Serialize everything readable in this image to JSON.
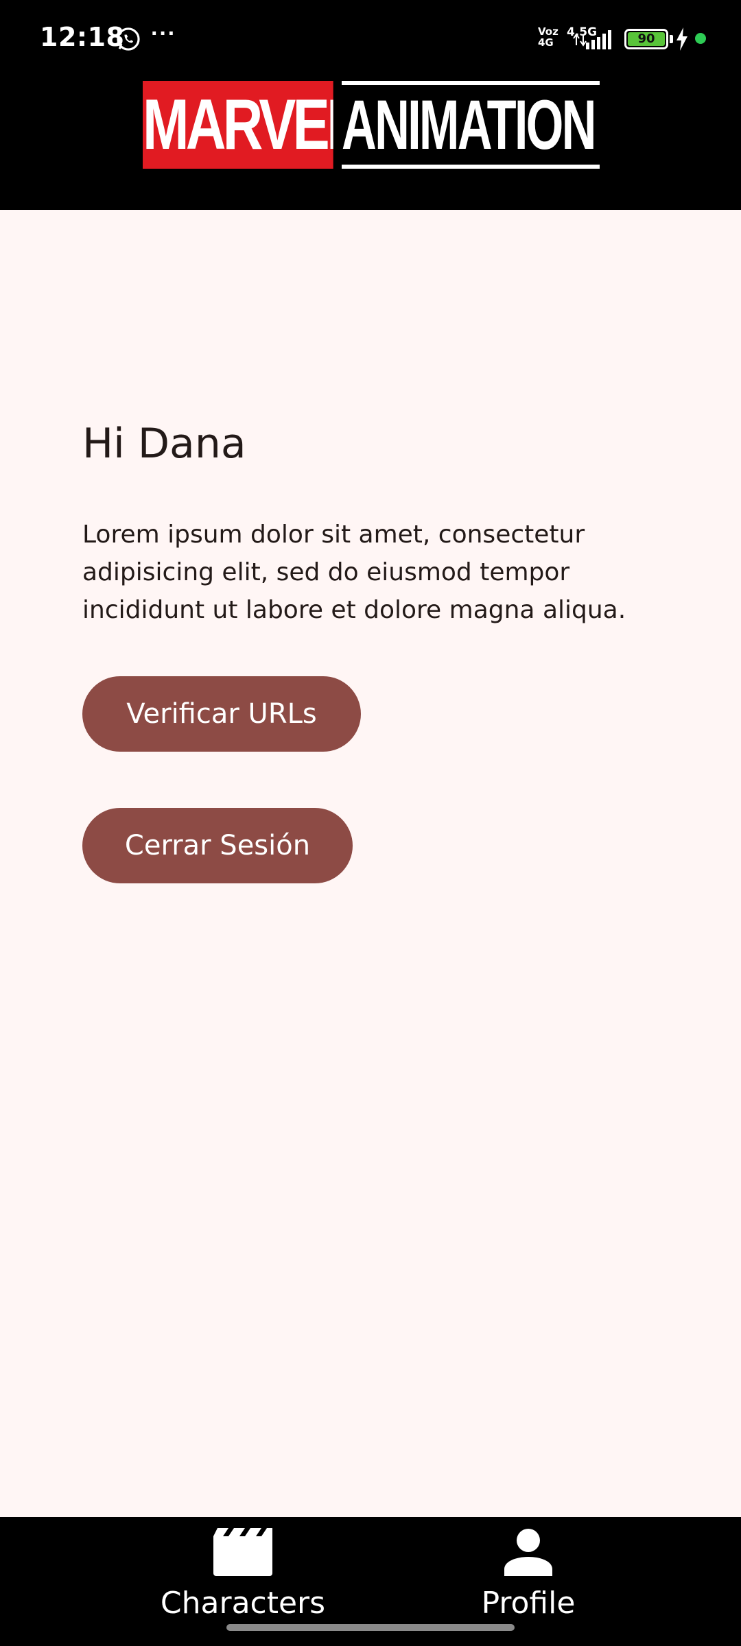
{
  "status_bar": {
    "time": "12:18",
    "more": "···",
    "network_type_top": "Voz",
    "network_type_bottom": "4G",
    "network_speed": "4.5G",
    "battery_level": "90",
    "icons": [
      "whatsapp-icon",
      "signal-icon",
      "battery-icon",
      "charging-icon"
    ]
  },
  "header": {
    "logo_left": "MARVEL",
    "logo_right": "ANIMATION"
  },
  "main": {
    "greeting": "Hi Dana",
    "description": "Lorem ipsum dolor sit amet, consectetur adipisicing elit, sed do eiusmod tempor incididunt ut labore et dolore magna aliqua.",
    "verify_button": "Verificar URLs",
    "logout_button": "Cerrar Sesión"
  },
  "bottom_nav": {
    "items": [
      {
        "label": "Characters",
        "icon": "clapperboard-icon"
      },
      {
        "label": "Profile",
        "icon": "person-icon"
      }
    ]
  },
  "colors": {
    "header_bg": "#000000",
    "page_bg": "#fff6f5",
    "button_bg": "#8d4b45",
    "marvel_red": "#e11b22",
    "battery_green": "#59c43a"
  }
}
